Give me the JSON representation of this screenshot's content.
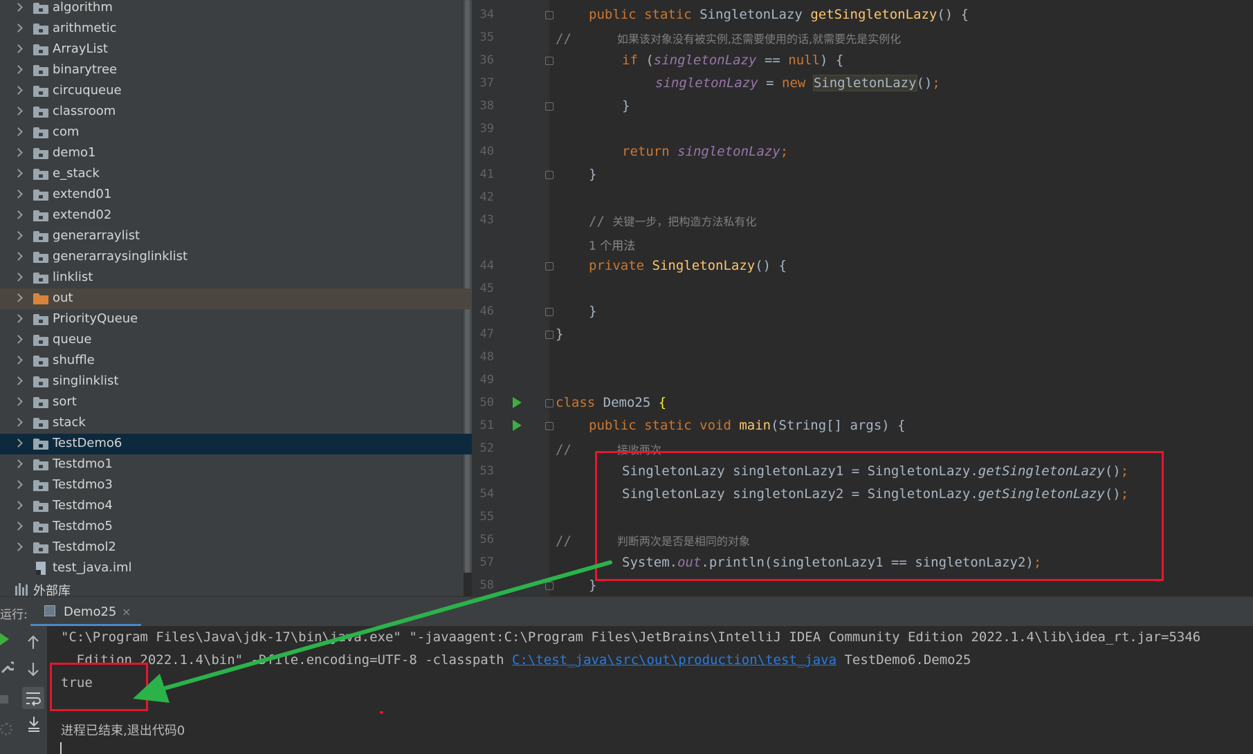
{
  "project_tree": {
    "items": [
      {
        "label": "algorithm",
        "type": "folder"
      },
      {
        "label": "arithmetic",
        "type": "folder"
      },
      {
        "label": "ArrayList",
        "type": "folder"
      },
      {
        "label": "binarytree",
        "type": "folder"
      },
      {
        "label": "circuqueue",
        "type": "folder"
      },
      {
        "label": "classroom",
        "type": "folder"
      },
      {
        "label": "com",
        "type": "folder"
      },
      {
        "label": "demo1",
        "type": "folder"
      },
      {
        "label": "e_stack",
        "type": "folder"
      },
      {
        "label": "extend01",
        "type": "folder"
      },
      {
        "label": "extend02",
        "type": "folder"
      },
      {
        "label": "generarraylist",
        "type": "folder"
      },
      {
        "label": "generarraysinglinklist",
        "type": "folder"
      },
      {
        "label": "linklist",
        "type": "folder"
      },
      {
        "label": "out",
        "type": "folder-excluded"
      },
      {
        "label": "PriorityQueue",
        "type": "folder"
      },
      {
        "label": "queue",
        "type": "folder"
      },
      {
        "label": "shuffle",
        "type": "folder"
      },
      {
        "label": "singlinklist",
        "type": "folder"
      },
      {
        "label": "sort",
        "type": "folder"
      },
      {
        "label": "stack",
        "type": "folder"
      },
      {
        "label": "TestDemo6",
        "type": "folder-selected"
      },
      {
        "label": "Testdmo1",
        "type": "folder"
      },
      {
        "label": "Testdmo3",
        "type": "folder"
      },
      {
        "label": "Testdmo4",
        "type": "folder"
      },
      {
        "label": "Testdmo5",
        "type": "folder"
      },
      {
        "label": "Testdmol2",
        "type": "folder"
      },
      {
        "label": "test_java.iml",
        "type": "file"
      }
    ],
    "external_libs": "外部库"
  },
  "editor": {
    "line_numbers": [
      "34",
      "35",
      "36",
      "37",
      "38",
      "39",
      "40",
      "41",
      "42",
      "43",
      "44",
      "45",
      "46",
      "47",
      "48",
      "49",
      "50",
      "51",
      "52",
      "53",
      "54",
      "55",
      "56",
      "57",
      "58"
    ],
    "l34": {
      "kw": "public static ",
      "type": "SingletonLazy ",
      "fn": "getSingletonLazy",
      "rest": "() {"
    },
    "l35": {
      "slash": "//",
      "text": "如果该对象没有被实例,还需要使用的话,就需要先是实例化"
    },
    "l36": {
      "kw": "if ",
      "open": "(",
      "var": "singletonLazy",
      "op": " == ",
      "kw2": "null",
      "rest": ") {"
    },
    "l37": {
      "var": "singletonLazy",
      "op": " = ",
      "kw": "new ",
      "ctor": "SingletonLazy",
      "rest": "()",
      "semi": ";"
    },
    "l38": "}",
    "l40": {
      "kw": "return ",
      "var": "singletonLazy",
      "semi": ";"
    },
    "l41": "}",
    "l43": {
      "slash": "// ",
      "text": "关键一步，把构造方法私有化"
    },
    "usage_hint": "1 个用法",
    "l44": {
      "kw": "private ",
      "fn": "SingletonLazy",
      "rest": "() {"
    },
    "l46": "}",
    "l47": "}",
    "l50": {
      "kw": "class ",
      "name": "Demo25 ",
      "brace": "{"
    },
    "l51": {
      "kw": "public static void ",
      "fn": "main",
      "rest": "(String[] args) {"
    },
    "l52": {
      "slash": "//",
      "text": "接收两次"
    },
    "l53": {
      "pre": "SingletonLazy singletonLazy1 = SingletonLazy.",
      "it": "getSingletonLazy",
      "rest": "()",
      "semi": ";"
    },
    "l54": {
      "pre": "SingletonLazy singletonLazy2 = SingletonLazy.",
      "it": "getSingletonLazy",
      "rest": "()",
      "semi": ";"
    },
    "l56": {
      "slash": "//",
      "text": "判断两次是否是相同的对象"
    },
    "l57": {
      "pre": "System.",
      "it": "out",
      "rest": ".println(singletonLazy1 == singletonLazy2)",
      "semi": ";"
    },
    "l58": "}"
  },
  "run_panel": {
    "label": "运行:",
    "tab": "Demo25",
    "close": "×"
  },
  "console": {
    "line1": "\"C:\\Program Files\\Java\\jdk-17\\bin\\java.exe\" \"-javaagent:C:\\Program Files\\JetBrains\\IntelliJ IDEA Community Edition 2022.1.4\\lib\\idea_rt.jar=5346",
    "line2_pre": "  Edition 2022.1.4\\bin\" -Dfile.encoding=UTF-8 -classpath ",
    "line2_link": "C:\\test_java\\src\\out\\production\\test_java",
    "line2_post": " TestDemo6.Demo25",
    "output": "true",
    "exit": "进程已结束,退出代码0"
  },
  "colors": {
    "annotation_box": "#e8162b",
    "annotation_arrow": "#2bb34a",
    "selection": "#0d293e",
    "link": "#287bde"
  }
}
